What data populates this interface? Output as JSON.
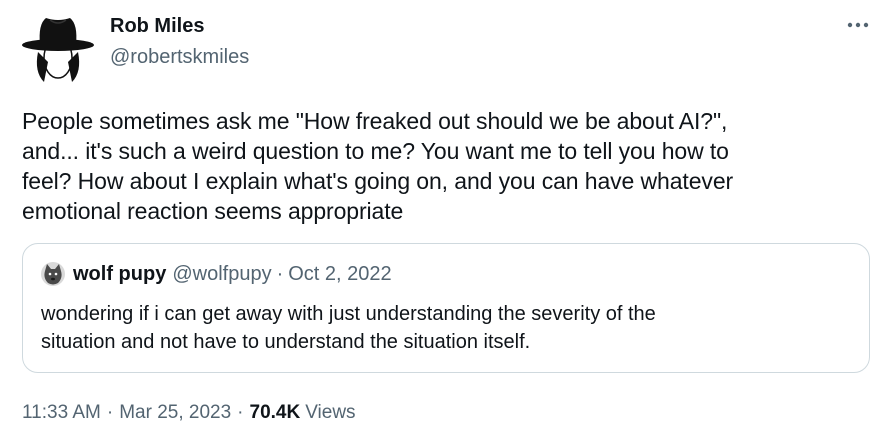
{
  "author": {
    "display_name": "Rob Miles",
    "handle": "@robertskmiles",
    "avatar_icon": "hat-silhouette-avatar-icon"
  },
  "more_icon": "more-options-icon",
  "tweet": {
    "lines": [
      "People sometimes ask me \"How freaked out should we be about AI?\",",
      "and... it's such a weird question to me? You want me to tell you how to",
      "feel? How about I explain what's going on, and you can have whatever",
      "emotional reaction seems appropriate"
    ]
  },
  "quote": {
    "display_name": "wolf pupy",
    "handle": "@wolfpupy",
    "separator": "·",
    "date": "Oct 2, 2022",
    "avatar_icon": "wolf-avatar-icon",
    "lines": [
      "wondering if i can get away with just understanding the severity of the",
      "situation and not have to understand the situation itself."
    ]
  },
  "meta": {
    "time": "11:33 AM",
    "separator": "·",
    "date": "Mar 25, 2023",
    "views_count": "70.4K",
    "views_label": "Views"
  },
  "colors": {
    "text_primary": "#0f1419",
    "text_secondary": "#536471",
    "border": "#cfd9de"
  }
}
